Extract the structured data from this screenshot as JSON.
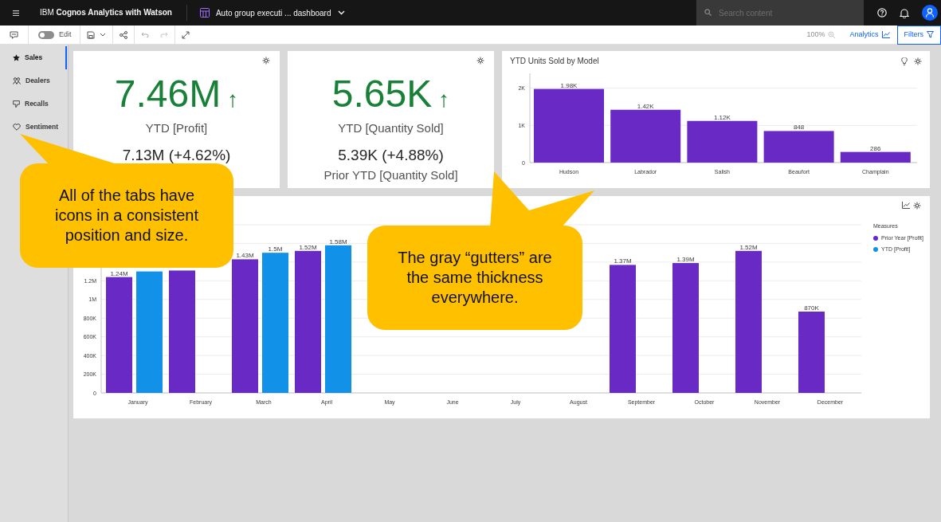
{
  "header": {
    "product_name": "IBM **Cognos Analytics with Watson**",
    "dashboard_title": "Auto group executi ... dashboard",
    "search": {
      "placeholder": "Search content"
    }
  },
  "toolbar": {
    "edit_toggle": {
      "label": "Edit",
      "on": false
    },
    "redo": {
      "disabled": true
    },
    "zoom_level": "100%",
    "analytics": "Analytics",
    "filters": {
      "label": "Filters",
      "selected": true
    }
  },
  "sidebar": {
    "tabs": [
      {
        "label": "Sales",
        "selected": true
      },
      {
        "label": "Dealers",
        "selected": false
      },
      {
        "label": "Recalls",
        "selected": false
      },
      {
        "label": "Sentiment",
        "selected": false
      }
    ]
  },
  "kpis": [
    {
      "value": "7.46M",
      "trend_arrow": "↑",
      "label": "YTD [Profit]",
      "comparison": "7.13M (+4.62%)"
    },
    {
      "value": "5.65K",
      "trend_arrow": "↑",
      "label": "YTD [Quantity Sold]",
      "comparison": "5.39K (+4.88%)",
      "comparison_label": "Prior YTD [Quantity Sold]"
    }
  ],
  "units_chart": {
    "title": "YTD Units Sold by Model",
    "chart_data": {
      "type": "bar",
      "categories": [
        "Hudson",
        "Labrador",
        "Salish",
        "Beaufort",
        "Champlain"
      ],
      "grid": true,
      "series": [
        {
          "color": "#6929c4",
          "values": [
            1980,
            1420,
            1120,
            848,
            286
          ]
        }
      ],
      "ylim": [
        0,
        2400
      ],
      "yticks": [
        {
          "value": 0,
          "label": "0"
        },
        {
          "value": 1000,
          "label": "1K"
        },
        {
          "value": 2000,
          "label": "2K"
        }
      ],
      "value_labels": [
        [
          "1.98K",
          "1.42K",
          "1.12K",
          "848",
          "286"
        ]
      ]
    }
  },
  "profit_chart": {
    "legend_title": "Measures",
    "chart_data": {
      "type": "bar",
      "categories": [
        "January",
        "February",
        "March",
        "April",
        "May",
        "June",
        "July",
        "August",
        "September",
        "October",
        "November",
        "December"
      ],
      "grid": true,
      "series": [
        {
          "name": "Prior Year [Profit]",
          "color": "#6929c4",
          "values": [
            1240000,
            1310000,
            1430000,
            1520000,
            null,
            null,
            null,
            null,
            1370000,
            1390000,
            1520000,
            870000
          ]
        },
        {
          "name": "YTD [Profit]",
          "color": "#1192e8",
          "values": [
            1300000,
            null,
            1500000,
            1580000,
            null,
            null,
            null,
            null,
            null,
            null,
            null,
            null
          ]
        }
      ],
      "ylim": [
        0,
        1800000
      ],
      "yticks": [
        {
          "value": 0,
          "label": "0"
        },
        {
          "value": 200000,
          "label": "200K"
        },
        {
          "value": 400000,
          "label": "400K"
        },
        {
          "value": 600000,
          "label": "600K"
        },
        {
          "value": 800000,
          "label": "800K"
        },
        {
          "value": 1000000,
          "label": "1M"
        },
        {
          "value": 1200000,
          "label": "1.2M"
        }
      ],
      "value_labels": [
        [
          "1.24M",
          null,
          "1.43M",
          "1.52M",
          null,
          null,
          null,
          null,
          "1.37M",
          "1.39M",
          "1.52M",
          "870K"
        ],
        [
          null,
          null,
          "1.5M",
          "1.58M",
          null,
          null,
          null,
          null,
          null,
          null,
          null,
          null
        ]
      ]
    }
  },
  "callouts": [
    {
      "text": "All of the tabs have icons in a consistent position and size."
    },
    {
      "text": "The gray “gutters” are the same thickness everywhere."
    }
  ]
}
